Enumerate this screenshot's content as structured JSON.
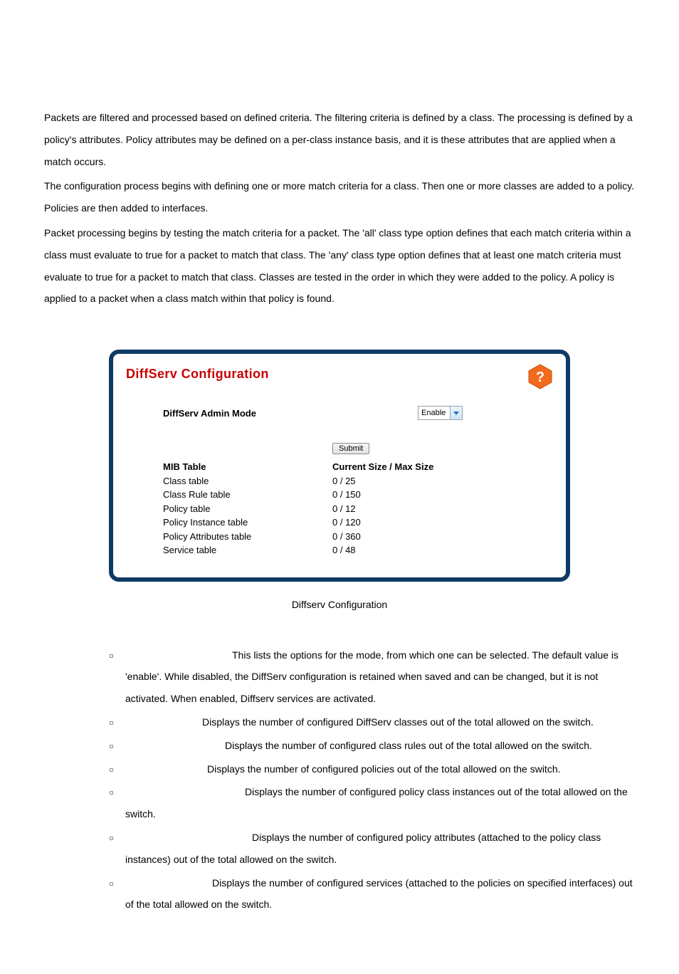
{
  "paragraphs": {
    "p1": "Packets are filtered and processed based on defined criteria. The filtering criteria is defined by a class. The processing is defined by a policy's attributes. Policy attributes may be defined on a per-class instance basis, and it is these attributes that are applied when a match occurs.",
    "p2": "The configuration process begins with defining one or more match criteria for a class. Then one or more classes are added to a policy. Policies are then added to interfaces.",
    "p3": "Packet processing begins by testing the match criteria for a packet. The 'all' class type option defines that each match criteria within a class must evaluate to true for a packet to match that class. The 'any' class type option defines that at least one match criteria must evaluate to true for a packet to match that class. Classes are tested in the order in which they were added to the policy. A policy is applied to a packet when a class match within that policy is found."
  },
  "panel": {
    "title": "DiffServ Configuration",
    "admin_mode_label": "DiffServ Admin Mode",
    "admin_mode_value": "Enable",
    "submit_label": "Submit",
    "mib_header_left": "MIB Table",
    "mib_header_right": "Current Size / Max Size",
    "rows": [
      {
        "name": "Class table",
        "value": "0 / 25"
      },
      {
        "name": "Class Rule table",
        "value": "0 / 150"
      },
      {
        "name": "Policy table",
        "value": "0 / 12"
      },
      {
        "name": "Policy Instance table",
        "value": "0 / 120"
      },
      {
        "name": "Policy Attributes table",
        "value": "0 / 360"
      },
      {
        "name": "Service table",
        "value": "0 / 48"
      }
    ]
  },
  "caption": "Diffserv Configuration",
  "defs": [
    {
      "indent": 150,
      "text": "This lists the options for the mode, from which one can be selected. The default value is 'enable'. While disabled, the DiffServ configuration is retained when saved and can be changed, but it is not activated. When enabled, Diffserv services are activated."
    },
    {
      "indent": 108,
      "text": "Displays the number of configured DiffServ classes out of the total allowed on the switch."
    },
    {
      "indent": 140,
      "text": "Displays the number of configured class rules out of the total allowed on the switch."
    },
    {
      "indent": 115,
      "text": "Displays the number of configured policies out of the total allowed on the switch."
    },
    {
      "indent": 168,
      "text": "Displays the number of configured policy class instances out of the total allowed on the switch."
    },
    {
      "indent": 178,
      "text": "Displays the number of configured policy attributes (attached to the policy class instances) out of the total allowed on the switch."
    },
    {
      "indent": 122,
      "text": "Displays the number of configured services (attached to the policies on specified interfaces) out of the total allowed on the switch."
    }
  ]
}
